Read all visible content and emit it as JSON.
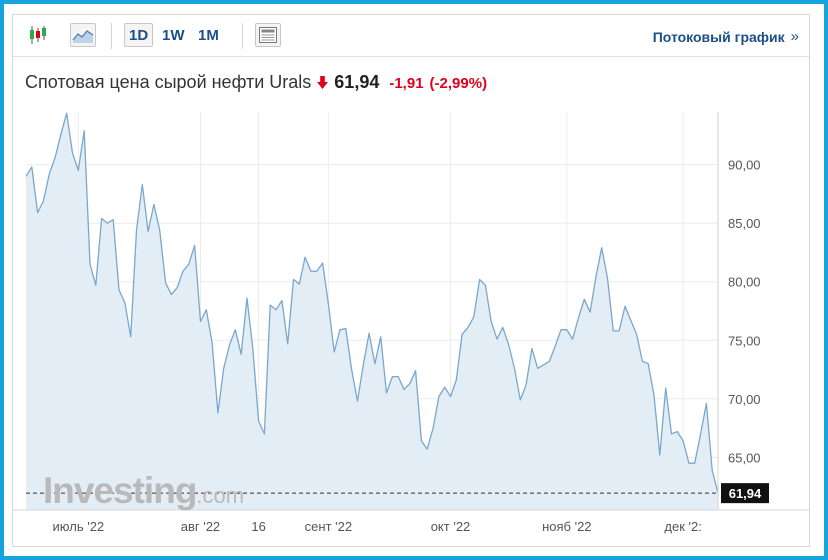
{
  "toolbar": {
    "icons": [
      "candlestick-icon",
      "area-chart-icon",
      "news-icon"
    ],
    "timeframes": [
      "1D",
      "1W",
      "1M"
    ],
    "active_timeframe": "1D",
    "stream_link_label": "Потоковый график",
    "stream_link_chevron": "»"
  },
  "quote": {
    "title": "Спотовая цена сырой нефти Urals",
    "direction_icon": "down-arrow-icon",
    "price": "61,94",
    "change": "-1,91",
    "change_pct": "(-2,99%)"
  },
  "colors": {
    "border": "#17a3dc",
    "line": "#7aa7cc",
    "fill": "#e3edf6",
    "down": "#e0001b",
    "link": "#1a4f87",
    "price_tag_bg": "#111111"
  },
  "watermark": {
    "brand": "Investing",
    "domain": ".com"
  },
  "chart_data": {
    "type": "area",
    "title": "Спотовая цена сырой нефти Urals",
    "ylim": [
      60.5,
      94.5
    ],
    "y_ticks": [
      "90,00",
      "85,00",
      "80,00",
      "75,00",
      "70,00",
      "65,00"
    ],
    "y_tick_values": [
      90,
      85,
      80,
      75,
      70,
      65
    ],
    "x_ticks": [
      "июль '22",
      "авг '22",
      "16",
      "сент '22",
      "окт '22",
      "нояб '22",
      "дек '2:"
    ],
    "x_tick_index": [
      9,
      30,
      40,
      52,
      73,
      93,
      113
    ],
    "last_value": 61.94,
    "last_value_label": "61,94",
    "grid": true,
    "series": [
      {
        "values": [
          89.0,
          89.8,
          85.9,
          86.9,
          89.2,
          90.6,
          92.6,
          94.4,
          91.0,
          89.5,
          92.9,
          81.5,
          79.7,
          85.4,
          85.0,
          85.3,
          79.3,
          78.2,
          75.3,
          84.4,
          88.3,
          84.3,
          86.6,
          84.4,
          79.9,
          78.9,
          79.5,
          80.9,
          81.5,
          83.1,
          76.6,
          77.6,
          74.8,
          68.8,
          72.6,
          74.6,
          75.9,
          73.8,
          78.6,
          74.3,
          68.1,
          67.0,
          78.0,
          77.6,
          78.4,
          74.7,
          80.2,
          79.8,
          82.1,
          80.9,
          80.9,
          81.6,
          78.1,
          74.0,
          75.9,
          76.0,
          72.5,
          69.8,
          72.9,
          75.6,
          73.0,
          75.3,
          70.5,
          71.9,
          71.9,
          70.8,
          71.3,
          72.4,
          66.4,
          65.7,
          67.5,
          70.2,
          71.0,
          70.2,
          71.6,
          75.5,
          76.1,
          77.0,
          80.2,
          79.7,
          76.6,
          75.1,
          76.1,
          74.6,
          72.6,
          69.9,
          71.2,
          74.3,
          72.6,
          72.9,
          73.2,
          74.5,
          75.9,
          75.9,
          75.1,
          76.9,
          78.5,
          77.4,
          80.4,
          82.9,
          80.3,
          75.8,
          75.8,
          77.9,
          76.7,
          75.5,
          73.2,
          73.0,
          70.3,
          65.2,
          70.9,
          67.0,
          67.2,
          66.4,
          64.5,
          64.5,
          67.0,
          69.6,
          63.9,
          61.94
        ]
      }
    ]
  }
}
